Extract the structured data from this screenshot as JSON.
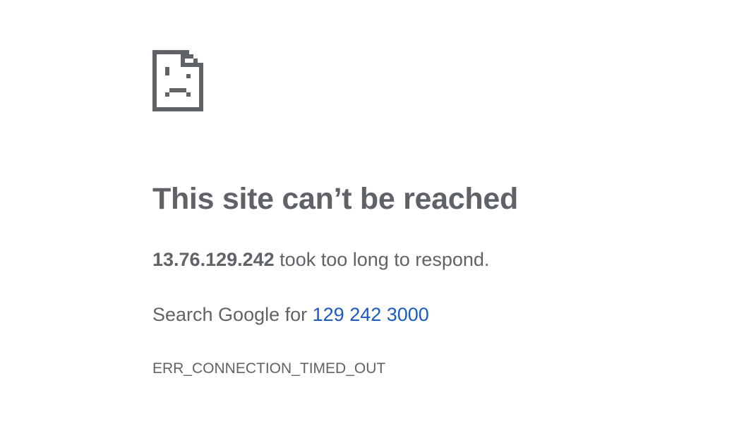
{
  "icon": {
    "name": "sad-page-icon",
    "color": "#5f6368"
  },
  "error": {
    "title": "This site can’t be reached",
    "host": "13.76.129.242",
    "message_suffix": " took too long to respond.",
    "search_prefix": "Search Google for ",
    "search_query": "129 242 3000",
    "code": "ERR_CONNECTION_TIMED_OUT"
  },
  "colors": {
    "text": "#5f6368",
    "link": "#1a5bbf",
    "background": "#ffffff"
  }
}
